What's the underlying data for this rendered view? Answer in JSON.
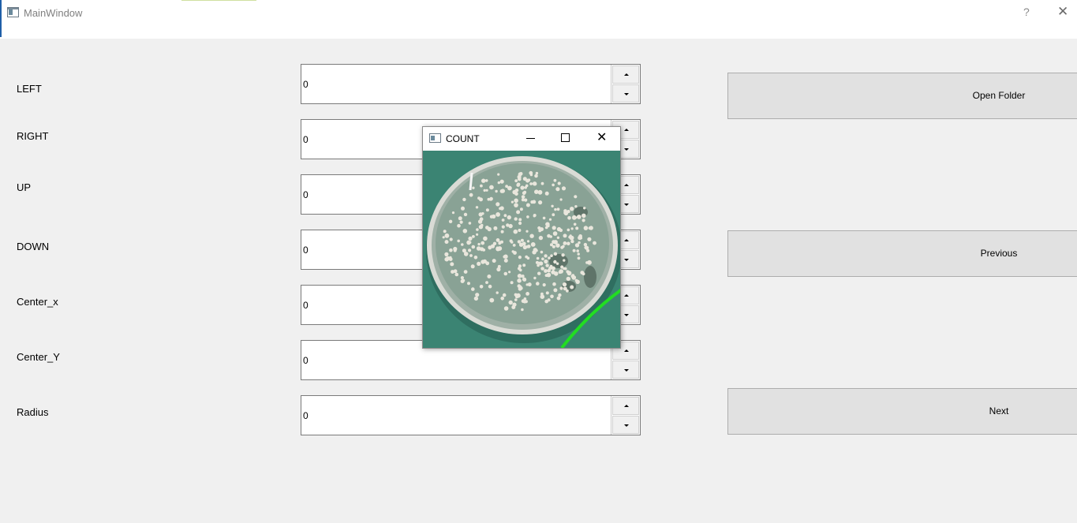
{
  "window": {
    "title": "MainWindow",
    "help_glyph": "?",
    "close_glyph": "✕"
  },
  "fields": [
    {
      "label": "LEFT",
      "value": "0"
    },
    {
      "label": "RIGHT",
      "value": "0"
    },
    {
      "label": "UP",
      "value": "0"
    },
    {
      "label": "DOWN",
      "value": "0"
    },
    {
      "label": "Center_x",
      "value": "0"
    },
    {
      "label": "Center_Y",
      "value": "0"
    },
    {
      "label": "Radius",
      "value": "0"
    }
  ],
  "buttons": {
    "open_folder": "Open Folder",
    "previous": "Previous",
    "next": "Next"
  },
  "count_window": {
    "title": "COUNT",
    "close_glyph": "✕"
  },
  "colors": {
    "background": "#f0f0f0",
    "button": "#e1e1e1",
    "plate_background": "#3b8473",
    "detection_line": "#22dd22"
  }
}
